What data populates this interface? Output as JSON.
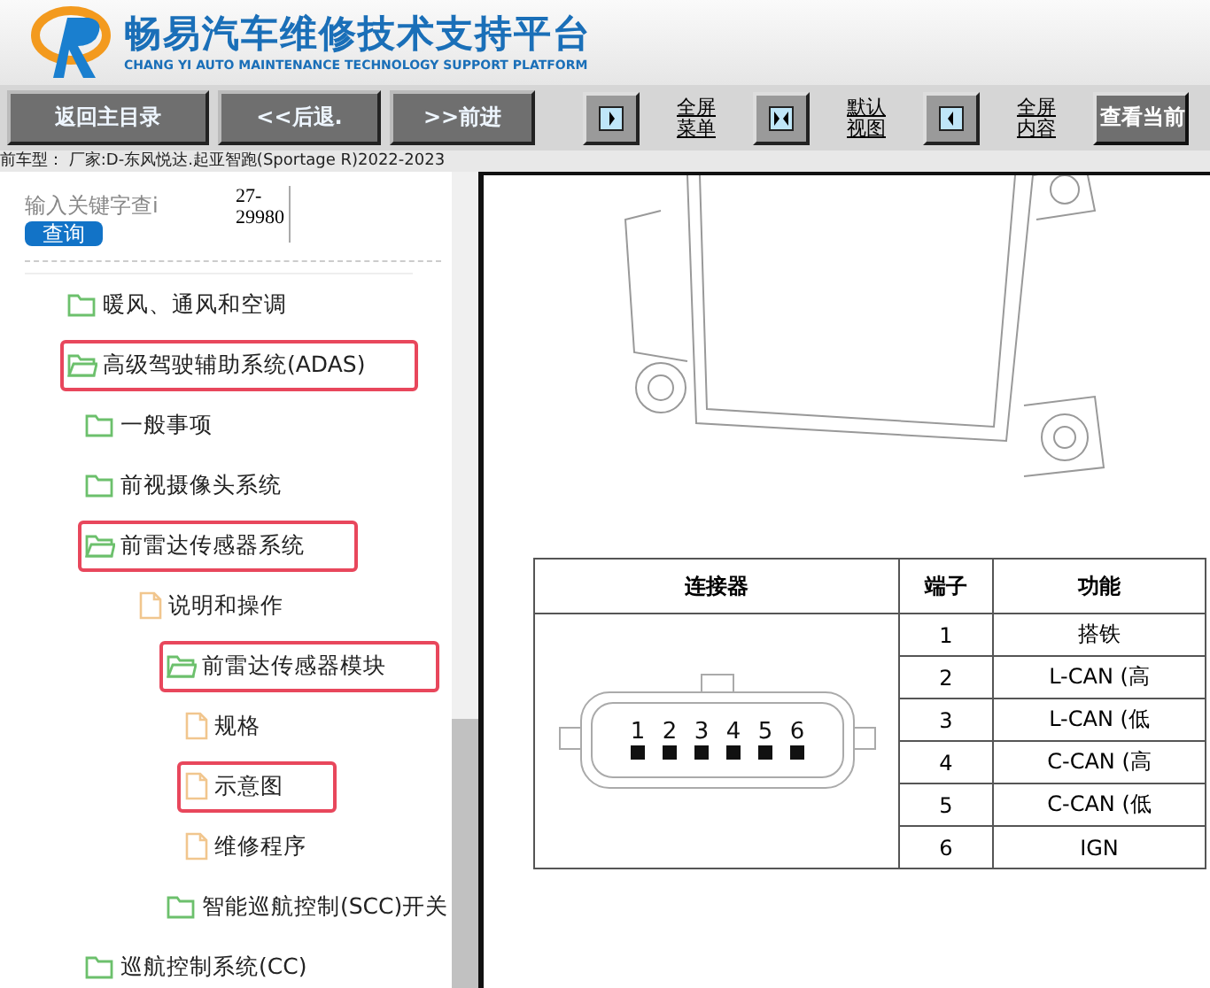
{
  "header": {
    "title": "畅易汽车维修技术支持平台",
    "subtitle": "CHANG YI AUTO MAINTENANCE TECHNOLOGY SUPPORT PLATFORM"
  },
  "toolbar": {
    "nav_buttons": [
      "返回主目录",
      "<<后退.",
      ">>前进"
    ],
    "view_buttons": [
      {
        "kind": "right",
        "label": [
          "全屏",
          "菜单"
        ]
      },
      {
        "kind": "both",
        "label": [
          "默认",
          "视图"
        ]
      },
      {
        "kind": "left",
        "label": [
          "全屏",
          "内容"
        ]
      }
    ],
    "view_current_button": "查看当前"
  },
  "vehicle_info": "前车型：  厂家:D-东风悦达.起亚智跑(Sportage R)2022-2023",
  "search": {
    "placeholder": "输入关键字查i",
    "code": [
      "27-",
      "29980"
    ],
    "button": "查询"
  },
  "tree": [
    {
      "label": "暖风、通风和空调",
      "kind": "folder",
      "expanded": false,
      "highlighted": false
    },
    {
      "label": "高级驾驶辅助系统(ADAS)",
      "kind": "folder",
      "expanded": true,
      "highlighted": true,
      "children": [
        {
          "label": "一般事项",
          "kind": "folder",
          "expanded": false,
          "highlighted": false
        },
        {
          "label": "前视摄像头系统",
          "kind": "folder",
          "expanded": false,
          "highlighted": false
        },
        {
          "label": "前雷达传感器系统",
          "kind": "folder",
          "expanded": true,
          "highlighted": true,
          "children": [
            {
              "label": "说明和操作",
              "kind": "doc",
              "highlighted": false
            },
            {
              "label": "前雷达传感器模块",
              "kind": "folder",
              "expanded": true,
              "highlighted": true,
              "children": [
                {
                  "label": "规格",
                  "kind": "doc",
                  "highlighted": false
                },
                {
                  "label": "示意图",
                  "kind": "doc",
                  "highlighted": true
                },
                {
                  "label": "维修程序",
                  "kind": "doc",
                  "highlighted": false
                }
              ]
            },
            {
              "label": "智能巡航控制(SCC)开关",
              "kind": "folder",
              "expanded": false,
              "highlighted": false
            }
          ]
        },
        {
          "label": "巡航控制系统(CC)",
          "kind": "folder",
          "expanded": false,
          "highlighted": false
        }
      ]
    }
  ],
  "pin_table": {
    "columns": [
      "连接器",
      "端子",
      "功能"
    ],
    "connector_pins": [
      "1",
      "2",
      "3",
      "4",
      "5",
      "6"
    ],
    "rows": [
      {
        "terminal": "1",
        "function": "搭铁"
      },
      {
        "terminal": "2",
        "function": "L-CAN (高"
      },
      {
        "terminal": "3",
        "function": "L-CAN (低"
      },
      {
        "terminal": "4",
        "function": "C-CAN (高"
      },
      {
        "terminal": "5",
        "function": "C-CAN (低"
      },
      {
        "terminal": "6",
        "function": "IGN"
      }
    ]
  }
}
